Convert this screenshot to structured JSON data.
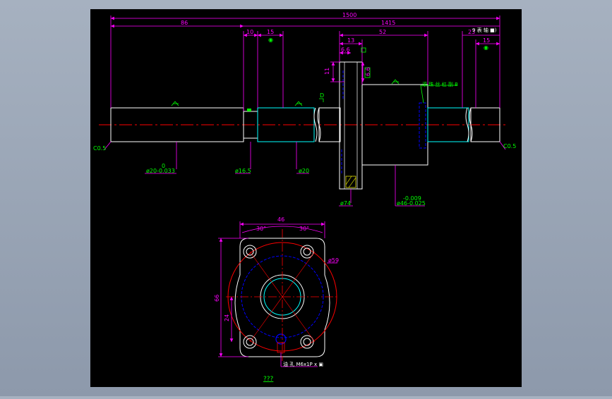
{
  "colors": {
    "background": "#a6b1c0",
    "canvas": "#000000",
    "outline": "#ffffff",
    "dimension": "#ff00ff",
    "annotation": "#00ff00",
    "centerline": "#ff0000",
    "hidden": "#0000ff",
    "bore": "#00ffff",
    "accent": "#ffff00"
  },
  "dimensions": {
    "overall_length": "1500",
    "thread_length": "1415",
    "left_journal": "86",
    "groove_width": "10",
    "seat_length": "15",
    "nut_flange_width": "13",
    "nut_body_length": "52",
    "flange_step": "6.6",
    "right_seat_length": "15",
    "right_end": "23",
    "flange_thickness": "11",
    "flange_offset": "6.6",
    "flange_width": "46",
    "bolt_circle": "ø59",
    "flange_height": "66",
    "center_height": "24",
    "angle_left": "30°",
    "angle_right": "30°"
  },
  "annotations": {
    "chamfer_left": "C0.5",
    "chamfer_right": "C0.5",
    "shaft_tol_top": "0",
    "shaft_diameter": "ø20-0.033",
    "groove_diameter": "ø16.5",
    "thread_diameter": "ø20",
    "flange_diameter": "ø74",
    "nut_tol_upper": "-0.009",
    "nut_diameter": "ø46-0.025",
    "datum_d": "D",
    "datum_b": "◉",
    "datum_c": "◉",
    "note_top_right": "9 表 轴 ■)",
    "note_nut": "滚 珠 丝 杠 副 B",
    "thread_callout": "油 孔 M6x1P x ▣",
    "caption": "???"
  }
}
